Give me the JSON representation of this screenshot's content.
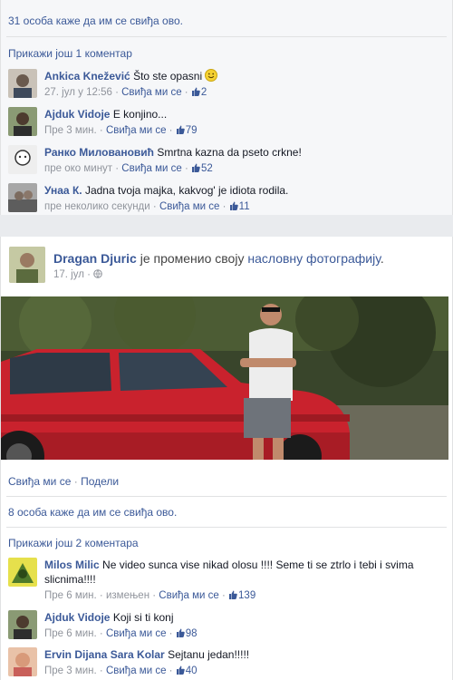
{
  "post1": {
    "likes_summary": "31 особа каже да им се свиђа ово.",
    "view_more": "Прикажи још 1 коментар",
    "comments": [
      {
        "name": "Ankica Knežević",
        "text": "Što ste opasni",
        "emoji": "smiley-emoji-icon",
        "time": "27. јул у 12:56",
        "like_label": "Свиђа ми се",
        "likes": "2"
      },
      {
        "name": "Ajduk Vidoje",
        "text": "E konjino...",
        "time": "Пре 3 мин.",
        "like_label": "Свиђа ми се",
        "likes": "79"
      },
      {
        "name": "Ранко Миловановић",
        "text": "Smrtna kazna da pseto crkne!",
        "time": "пре око минут",
        "like_label": "Свиђа ми се",
        "likes": "52"
      },
      {
        "name": "Унаа К.",
        "text": "Jadna tvoja majka, kakvog' je idiota rodila.",
        "time": "пре неколико секунди",
        "like_label": "Свиђа ми се",
        "likes": "11"
      }
    ]
  },
  "post2": {
    "author": "Dragan Djuric",
    "action_text": "је променио своју",
    "action_link": "насловну фотографију",
    "action_end": ".",
    "date": "17. јул",
    "privacy_icon": "globe-icon",
    "actions": {
      "like": "Свиђа ми се",
      "separator": "·",
      "share": "Подели"
    },
    "likes_summary": "8 особа каже да им се свиђа ово.",
    "view_more": "Прикажи још 2 коментара",
    "comments": [
      {
        "name": "Milos Milic",
        "text": "Ne video sunca vise nikad olosu !!!! Seme ti se ztrlo i tebi i svima slicnima!!!!",
        "time": "Пре 6 мин.",
        "edited": "измењен",
        "like_label": "Свиђа ми се",
        "likes": "139"
      },
      {
        "name": "Ajduk Vidoje",
        "text": "Koji si ti konj",
        "time": "Пре 6 мин.",
        "like_label": "Свиђа ми се",
        "likes": "98"
      },
      {
        "name": "Ervin Dijana Sara Kolar",
        "text": "Sejtanu jedan!!!!!",
        "time": "Пре 3 мин.",
        "like_label": "Свиђа ми се",
        "likes": "40"
      }
    ]
  },
  "colors": {
    "link": "#3b5998",
    "meta": "#90949c",
    "background": "#f6f7f9"
  }
}
